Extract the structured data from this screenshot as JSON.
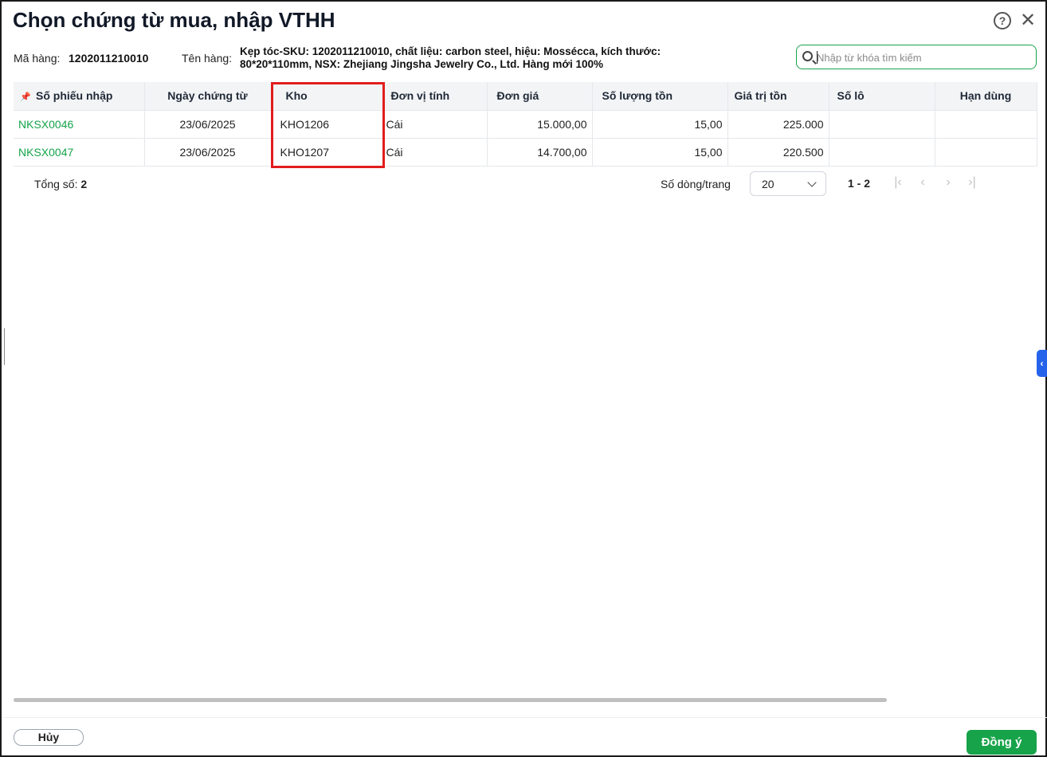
{
  "dialog": {
    "title": "Chọn chứng từ mua, nhập VTHH",
    "help_icon": "question-circle-icon",
    "close_icon": "close-icon"
  },
  "item_info": {
    "code_label": "Mã hàng:",
    "code_value": "1202011210010",
    "name_label": "Tên hàng:",
    "name_line1": "Kẹp tóc-SKU: 1202011210010, chất liệu: carbon steel, hiệu: Mossécca, kích thước:",
    "name_line2": "80*20*110mm, NSX: Zhejiang Jingsha Jewelry Co., Ltd. Hàng mới 100%"
  },
  "search": {
    "placeholder": "Nhập từ khóa tìm kiếm",
    "value": ""
  },
  "table": {
    "columns": [
      "Số phiếu nhập",
      "Ngày chứng từ",
      "Kho",
      "Đơn vị tính",
      "Đơn giá",
      "Số lượng tồn",
      "Giá trị tồn",
      "Số lô",
      "Hạn dùng"
    ],
    "rows": [
      {
        "so_phieu": "NKSX0046",
        "ngay": "23/06/2025",
        "kho": "KHO1206",
        "dvt": "Cái",
        "don_gia": "15.000,00",
        "so_luong": "15,00",
        "gia_tri": "225.000",
        "so_lo": "",
        "han_dung": ""
      },
      {
        "so_phieu": "NKSX0047",
        "ngay": "23/06/2025",
        "kho": "KHO1207",
        "dvt": "Cái",
        "don_gia": "14.700,00",
        "so_luong": "15,00",
        "gia_tri": "220.500",
        "so_lo": "",
        "han_dung": ""
      }
    ]
  },
  "pager": {
    "total_label": "Tổng số:",
    "total_value": "2",
    "rows_per_page_label": "Số dòng/trang",
    "rows_per_page": "20",
    "range": "1 - 2"
  },
  "footer": {
    "cancel_label": "Hủy",
    "ok_label": "Đồng ý"
  },
  "colors": {
    "accent": "#16a34a",
    "highlight": "#e11d1d",
    "side_tab": "#2563eb"
  }
}
